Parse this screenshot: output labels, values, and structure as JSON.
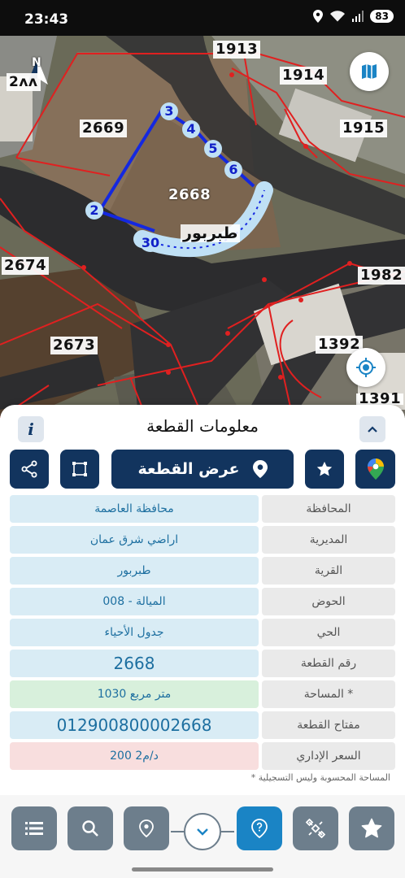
{
  "status_bar": {
    "time": "23:43",
    "battery": "83"
  },
  "map": {
    "compass_letter": "N",
    "parcel_labels": {
      "p1913": "1913",
      "p1914": "1914",
      "p1915": "1915",
      "p2669": "2669",
      "p2668": "2668",
      "p2674": "2674",
      "p2673": "2673",
      "p1982": "1982",
      "p1392": "1392",
      "p1391": "1391",
      "p2679": "2ᴧᴧ"
    },
    "area_label": "طبربور",
    "vertices": {
      "v2": "2",
      "v3": "3",
      "v4": "4",
      "v5": "5",
      "v6": "6",
      "v30": "30"
    }
  },
  "panel": {
    "title": "معلومات القطعة",
    "show_parcel_button": "عرض القطعة",
    "rows": [
      {
        "key": "المحافظة",
        "value": "محافظة العاصمة"
      },
      {
        "key": "المديرية",
        "value": "اراضي شرق عمان"
      },
      {
        "key": "القرية",
        "value": "طبربور"
      },
      {
        "key": "الحوض",
        "value": "الميالة - 008"
      },
      {
        "key": "الحي",
        "value": "جدول الأحياء"
      },
      {
        "key": "رقم القطعة",
        "value": "2668"
      },
      {
        "key": "المساحة *",
        "value": "1030  متر مربع"
      },
      {
        "key": "مفتاح القطعة",
        "value": "012900800002668"
      },
      {
        "key": "السعر الإداري",
        "value": "200 د/م2"
      }
    ],
    "footnote": "* المساحة المحسوبة وليس التسجيلية"
  },
  "icons": {
    "accent": "#12345e",
    "active": "#1a84c5",
    "bottom_bar": [
      "list-icon",
      "search-icon",
      "location-pin-icon",
      "chevron-down-icon",
      "help-pin-icon",
      "satellite-icon",
      "star-icon"
    ]
  }
}
